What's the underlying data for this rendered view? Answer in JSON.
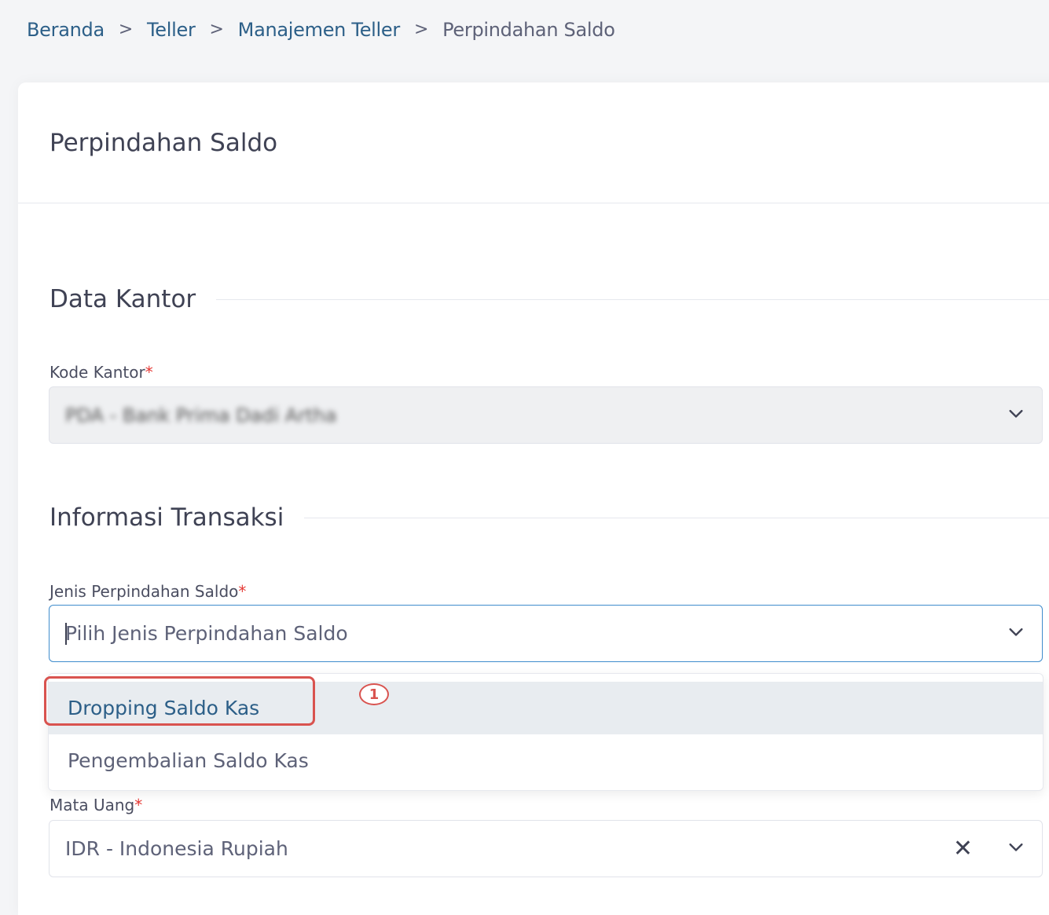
{
  "breadcrumb": {
    "items": [
      "Beranda",
      "Teller",
      "Manajemen Teller"
    ],
    "current": "Perpindahan Saldo",
    "separator": ">"
  },
  "page": {
    "title": "Perpindahan Saldo"
  },
  "sections": {
    "data_kantor": {
      "title": "Data Kantor",
      "kode_kantor_label": "Kode Kantor",
      "kode_kantor_value": "PDA - Bank Prima Dadi Artha"
    },
    "informasi_transaksi": {
      "title": "Informasi Transaksi",
      "jenis_label": "Jenis Perpindahan Saldo",
      "jenis_placeholder": "Pilih Jenis Perpindahan Saldo",
      "jenis_options": [
        "Dropping Saldo Kas",
        "Pengembalian Saldo Kas"
      ],
      "mata_uang_label": "Mata Uang",
      "mata_uang_value": "IDR - Indonesia Rupiah"
    }
  },
  "required_marker": "*",
  "annotation": {
    "step_number": "1"
  },
  "icons": {
    "chevron": "chevron-down-icon",
    "clear": "close-icon"
  },
  "colors": {
    "link": "#2c5f88",
    "required": "#e53935",
    "focus_border": "#3f8ccc",
    "annotation": "#d9534f",
    "active_option_bg": "#e8ecf0"
  },
  "clear_glyph": "✕"
}
